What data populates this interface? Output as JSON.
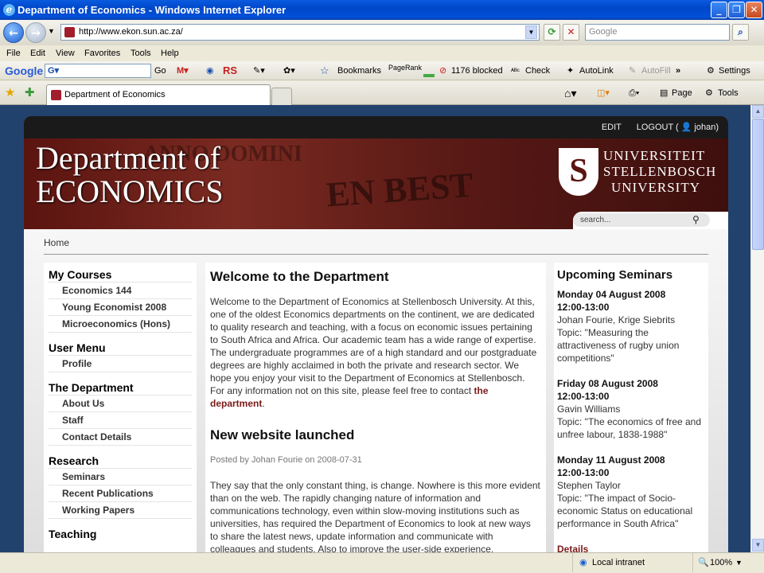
{
  "window": {
    "title": "Department of Economics - Windows Internet Explorer"
  },
  "address": {
    "url": "http://www.ekon.sun.ac.za/",
    "search_placeholder": "Google"
  },
  "menu": [
    "File",
    "Edit",
    "View",
    "Favorites",
    "Tools",
    "Help"
  ],
  "google_toolbar": {
    "logo": "Google",
    "go": "Go",
    "rs": "RS",
    "bookmarks": "Bookmarks",
    "pagerank": "PageRank",
    "blocked": "1176 blocked",
    "check": "Check",
    "autolink": "AutoLink",
    "autofill": "AutoFill",
    "settings": "Settings"
  },
  "tabs": {
    "active": "Department of Economics",
    "page": "Page",
    "tools": "Tools"
  },
  "site": {
    "edit": "EDIT",
    "logout": "LOGOUT (",
    "user": "johan)",
    "title_line1": "Department of",
    "title_line2": "ECONOMICS",
    "logo_line1": "UNIVERSITEIT",
    "logo_line2": "STELLENBOSCH",
    "logo_line3": "UNIVERSITY",
    "banner_text1": "EN BEST",
    "search_placeholder": "search...",
    "breadcrumb": "Home"
  },
  "sidebar": [
    {
      "heading": "My Courses",
      "items": [
        "Economics 144",
        "Young Economist 2008",
        "Microeconomics (Hons)"
      ]
    },
    {
      "heading": "User Menu",
      "items": [
        "Profile"
      ]
    },
    {
      "heading": "The Department",
      "items": [
        "About Us",
        "Staff",
        "Contact Details"
      ]
    },
    {
      "heading": "Research",
      "items": [
        "Seminars",
        "Recent Publications",
        "Working Papers"
      ]
    },
    {
      "heading": "Teaching",
      "items": []
    }
  ],
  "main": {
    "welcome_title": "Welcome to the Department",
    "welcome_text": "Welcome to the Department of Economics at Stellenbosch University. At this, one of the oldest Economics departments on the continent, we are dedicated to quality research and teaching, with a focus on economic issues pertaining to South Africa and Africa. Our academic team has a wide range of expertise. The undergraduate programmes are of a high standard and our postgraduate degrees are highly acclaimed in both the private and research sector. We hope you enjoy your visit to the Department of Economics at Stellenbosch. For any information not on this site, please feel free to contact ",
    "welcome_link": "the department",
    "welcome_end": ".",
    "post_title": "New website launched",
    "post_meta": "Posted by Johan Fourie on 2008-07-31",
    "post_text": "They say that the only constant thing, is change. Nowhere is this more evident than on the web. The rapidly changing nature of information and communications technology, even within slow-moving institutions such as universities, has required the Department of Economics to look at new ways to share the latest news, update information and communicate with colleagues and students. Also to improve the user-side experience."
  },
  "seminars": {
    "title": "Upcoming Seminars",
    "items": [
      {
        "date": "Monday 04 August 2008",
        "time": "12:00-13:00",
        "speaker": "Johan Fourie, Krige Siebrits",
        "topic": "Topic: \"Measuring the attractiveness of rugby union competitions\""
      },
      {
        "date": "Friday 08 August 2008",
        "time": "12:00-13:00",
        "speaker": "Gavin Williams",
        "topic": "Topic: \"The economics of free and unfree labour, 1838-1988\""
      },
      {
        "date": "Monday 11 August 2008",
        "time": "12:00-13:00",
        "speaker": "Stephen Taylor",
        "topic": "Topic: \"The impact of Socio-economic Status on educational performance in South Africa\""
      }
    ],
    "details": "Details"
  },
  "status": {
    "zone": "Local intranet",
    "zoom": "100%"
  }
}
